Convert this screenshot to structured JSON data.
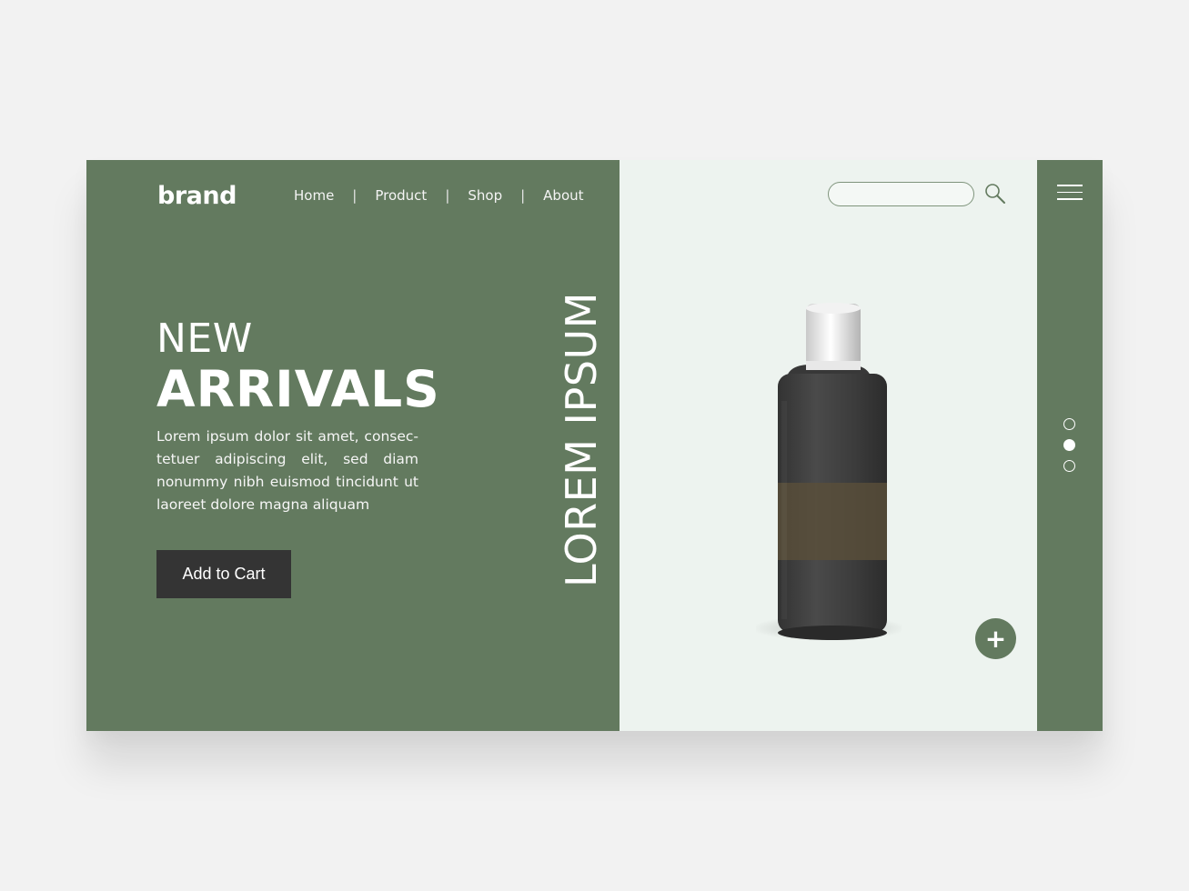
{
  "brand": {
    "name": "brand"
  },
  "nav": {
    "items": [
      {
        "label": "Home"
      },
      {
        "label": "Product"
      },
      {
        "label": "Shop"
      },
      {
        "label": "About"
      }
    ],
    "separator": "|"
  },
  "hero": {
    "title_line1": "NEW",
    "title_line2": "ARRIVALS",
    "description": "Lorem ipsum dolor sit amet, consec- tetuer adipiscing elit, sed diam nonummy nibh euismod tincidunt ut laoreet dolore magna aliquam",
    "cart_button": "Add to Cart",
    "vertical_text": "LOREM IPSUM"
  },
  "search": {
    "placeholder": ""
  },
  "product": {
    "add_symbol": "+"
  },
  "slider": {
    "total": 3,
    "active_index": 1
  },
  "colors": {
    "green": "#637a5f",
    "light_panel": "#edf3ef",
    "button_dark": "#343434",
    "background": "#f2f2f2"
  },
  "icons": [
    "search-icon",
    "menu-icon",
    "plus-icon"
  ]
}
